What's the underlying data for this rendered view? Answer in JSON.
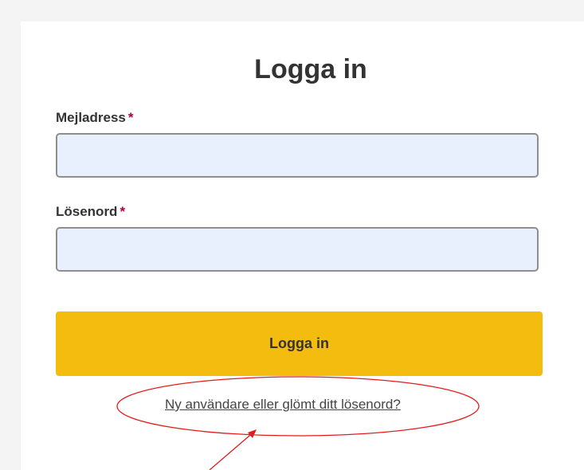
{
  "form": {
    "title": "Logga in",
    "email": {
      "label": "Mejladress",
      "required_marker": "*",
      "value": "",
      "placeholder": ""
    },
    "password": {
      "label": "Lösenord",
      "required_marker": "*",
      "value": "",
      "placeholder": ""
    },
    "submit_label": "Logga in",
    "forgot_link": "Ny användare eller glömt ditt lösenord?"
  },
  "colors": {
    "button": "#f4bc0f",
    "input_background": "#e8f0fe",
    "required_marker": "#b0003a",
    "annotation": "#e31b1b"
  }
}
